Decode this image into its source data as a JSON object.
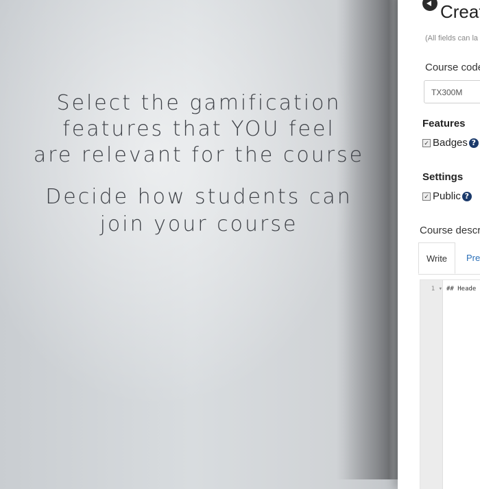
{
  "caption": {
    "line1": "Select the gamification",
    "line2": "features that YOU feel",
    "line3": "are relevant for the course",
    "line4": "Decide how students can",
    "line5": "join your course"
  },
  "app": {
    "page_title": "Creat",
    "hint": "(All fields can la",
    "course_code": {
      "label": "Course code",
      "value": "TX300M"
    },
    "features": {
      "title": "Features",
      "badges_label": "Badges",
      "badges_checked": true
    },
    "settings": {
      "title": "Settings",
      "public_label": "Public",
      "public_checked": true
    },
    "description": {
      "label": "Course descrip",
      "tabs": [
        "Write",
        "Pre"
      ],
      "active_tab": "Write",
      "editor": {
        "line_number": "1",
        "fold_marker": "▾",
        "content": "## Heade"
      }
    },
    "icons": {
      "back": "back-arrow-circle-icon",
      "help": "question-circle-icon",
      "checkbox": "checkbox-checked-icon"
    },
    "help_glyph": "?",
    "check_glyph": "✓"
  }
}
